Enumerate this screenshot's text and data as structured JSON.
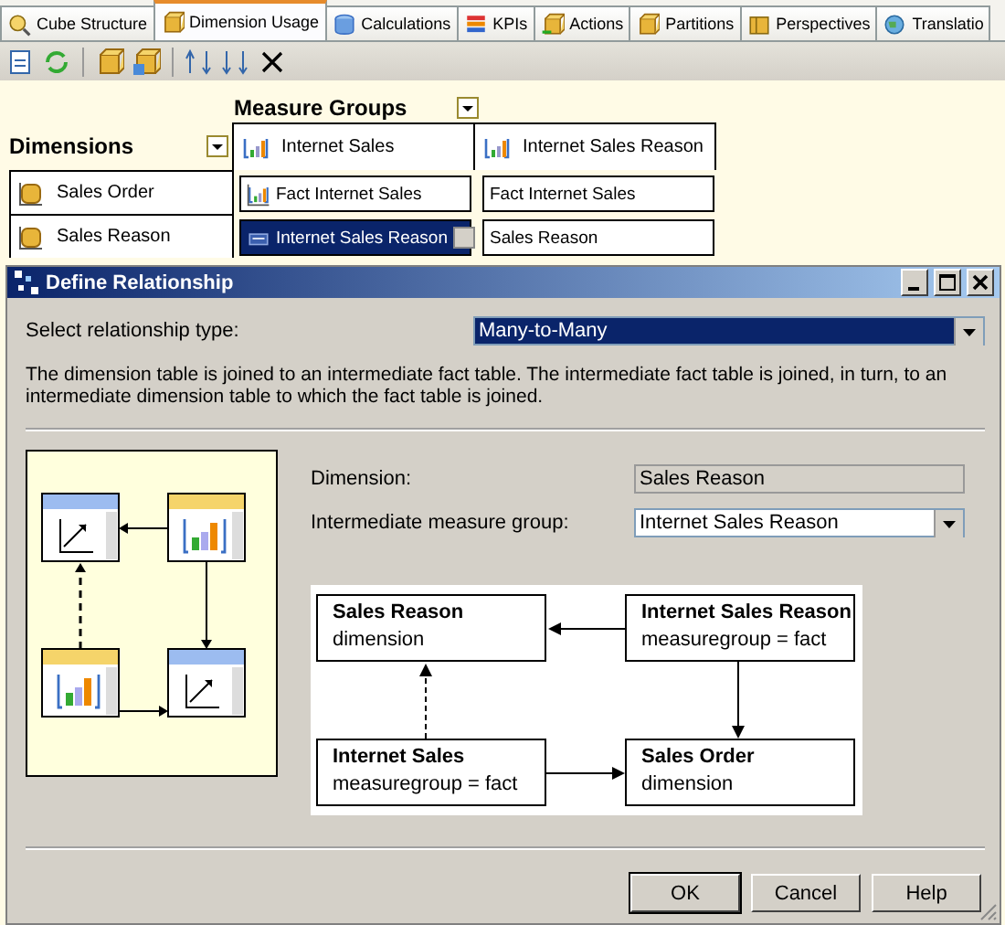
{
  "tabs": [
    {
      "label": "Cube Structure",
      "selected": false
    },
    {
      "label": "Dimension Usage",
      "selected": true
    },
    {
      "label": "Calculations",
      "selected": false
    },
    {
      "label": "KPIs",
      "selected": false
    },
    {
      "label": "Actions",
      "selected": false
    },
    {
      "label": "Partitions",
      "selected": false
    },
    {
      "label": "Perspectives",
      "selected": false
    },
    {
      "label": "Translatio",
      "selected": false
    }
  ],
  "grid": {
    "measure_groups_label": "Measure Groups",
    "dimensions_label": "Dimensions",
    "columns": [
      "Internet Sales",
      "Internet Sales Reason"
    ],
    "rows": [
      {
        "dimension": "Sales Order",
        "cells": [
          {
            "text": "Fact Internet Sales",
            "kind": "fact",
            "selected": false
          },
          {
            "text": "Fact Internet Sales",
            "kind": "plain",
            "selected": false
          }
        ]
      },
      {
        "dimension": "Sales Reason",
        "cells": [
          {
            "text": "Internet Sales Reason",
            "kind": "many",
            "selected": true
          },
          {
            "text": "Sales Reason",
            "kind": "plain",
            "selected": false
          }
        ]
      }
    ]
  },
  "dialog": {
    "title": "Define Relationship",
    "relationship_label": "Select relationship type:",
    "relationship_value": "Many-to-Many",
    "description": "The dimension table is joined to an intermediate fact table. The intermediate fact table is joined, in turn, to an intermediate dimension table to which the fact table is joined.",
    "dimension_label": "Dimension:",
    "dimension_value": "Sales Reason",
    "intermediate_label": "Intermediate measure group:",
    "intermediate_value": "Internet Sales Reason",
    "diagram": {
      "nodes": [
        {
          "title": "Sales Reason",
          "subtitle": "dimension"
        },
        {
          "title": "Internet Sales Reason",
          "subtitle": "measuregroup = fact"
        },
        {
          "title": "Internet Sales",
          "subtitle": "measuregroup = fact"
        },
        {
          "title": "Sales Order",
          "subtitle": "dimension"
        }
      ]
    },
    "buttons": [
      {
        "label": "OK",
        "default": true
      },
      {
        "label": "Cancel",
        "default": false
      },
      {
        "label": "Help",
        "default": false
      }
    ]
  }
}
